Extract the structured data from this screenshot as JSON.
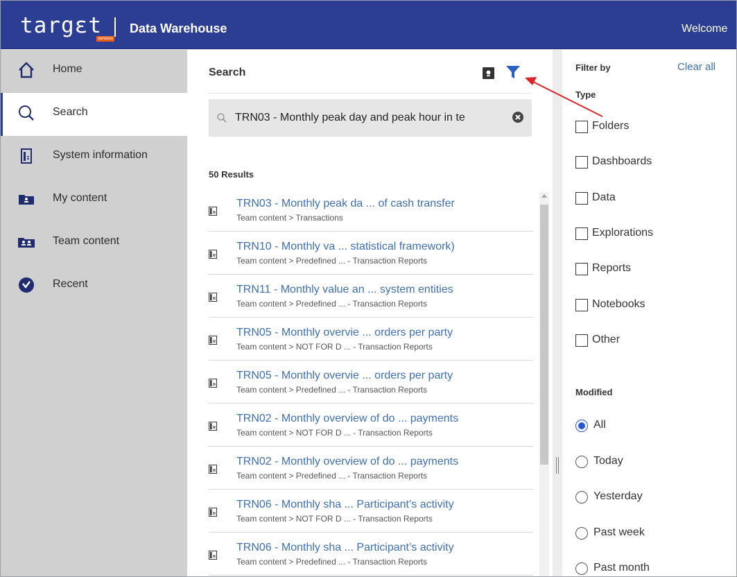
{
  "header": {
    "logo_text": "targεt",
    "logo_sub": "services",
    "app_title": "Data Warehouse",
    "welcome": "Welcome"
  },
  "sidebar": {
    "items": [
      {
        "label": "Home",
        "icon": "home-icon"
      },
      {
        "label": "Search",
        "icon": "search-icon",
        "active": true
      },
      {
        "label": "System information",
        "icon": "report-icon"
      },
      {
        "label": "My content",
        "icon": "folder-user-icon"
      },
      {
        "label": "Team content",
        "icon": "folder-team-icon"
      },
      {
        "label": "Recent",
        "icon": "recent-icon"
      }
    ]
  },
  "search": {
    "title": "Search",
    "query": "TRN03 - Monthly peak day and peak hour in te",
    "results_count": "50 Results",
    "results": [
      {
        "title": "TRN03 - Monthly peak da ... of cash transfer",
        "path": "Team content > Transactions"
      },
      {
        "title": "TRN10 - Monthly va ... statistical framework)",
        "path": "Team content > Predefined ... - Transaction Reports"
      },
      {
        "title": "TRN11 - Monthly value an ... system entities",
        "path": "Team content > Predefined ... - Transaction Reports"
      },
      {
        "title": "TRN05 - Monthly overvie ... orders per party",
        "path": "Team content > NOT FOR D ... - Transaction Reports"
      },
      {
        "title": "TRN05 - Monthly overvie ... orders per party",
        "path": "Team content > Predefined ... - Transaction Reports"
      },
      {
        "title": "TRN02 - Monthly overview of do ... payments",
        "path": "Team content > NOT FOR D ... - Transaction Reports"
      },
      {
        "title": "TRN02 - Monthly overview of do ... payments",
        "path": "Team content > Predefined ... - Transaction Reports"
      },
      {
        "title": "TRN06 - Monthly sha ... Participant’s activity",
        "path": "Team content > NOT FOR D ... - Transaction Reports"
      },
      {
        "title": "TRN06 - Monthly sha ... Participant’s activity",
        "path": "Team content > Predefined ... - Transaction Reports"
      }
    ]
  },
  "filter": {
    "title": "Filter by",
    "clear_all": "Clear all",
    "type_title": "Type",
    "types": [
      "Folders",
      "Dashboards",
      "Data",
      "Explorations",
      "Reports",
      "Notebooks",
      "Other"
    ],
    "modified_title": "Modified",
    "modified_options": [
      "All",
      "Today",
      "Yesterday",
      "Past week",
      "Past month"
    ],
    "modified_selected": "All"
  },
  "colors": {
    "header_bg": "#2c3e93",
    "link": "#3d6fb5",
    "sidebar_bg": "#d0d0d0",
    "annotation_arrow": "#e02424",
    "radio_selected": "#2557d6"
  }
}
